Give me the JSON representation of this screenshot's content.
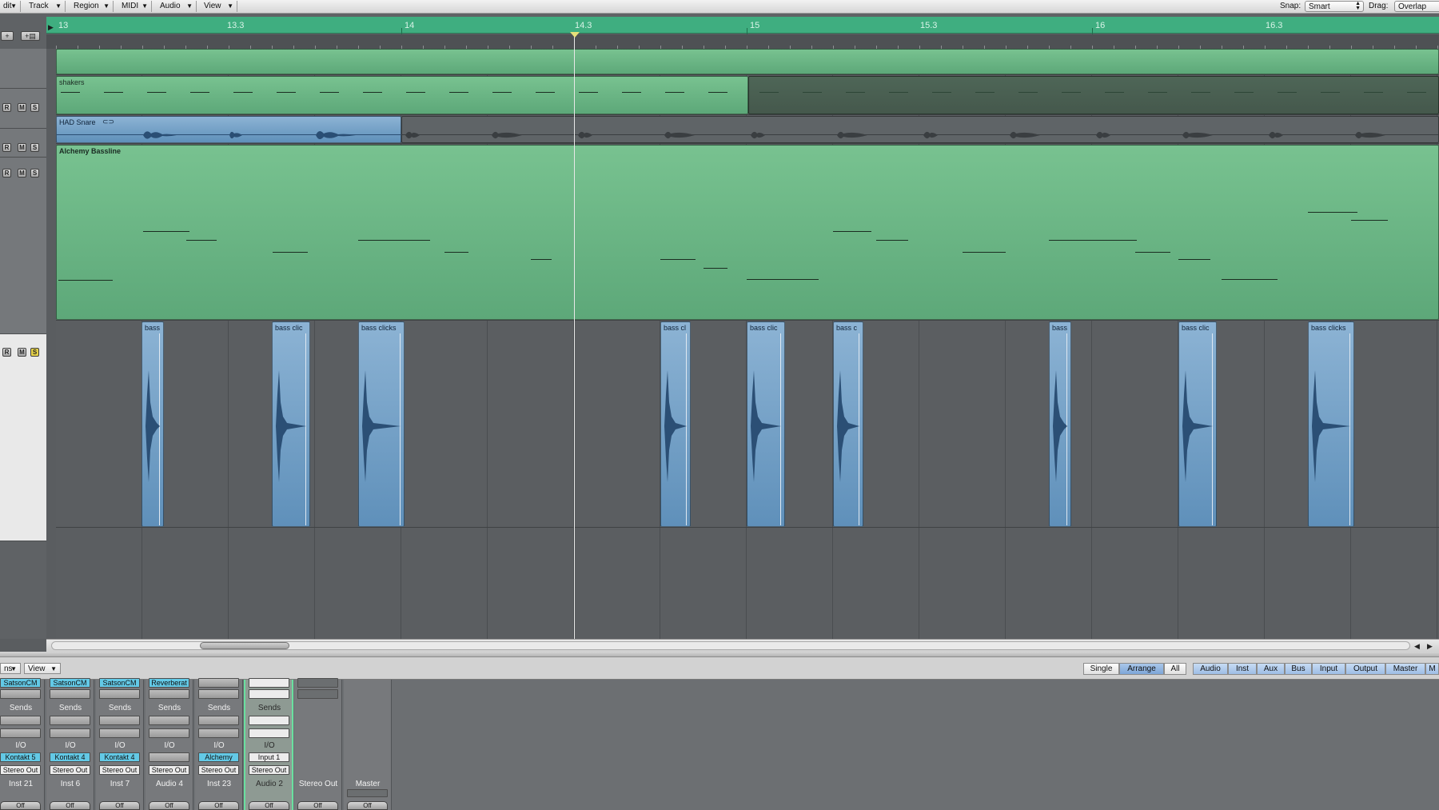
{
  "menubar": {
    "items": [
      {
        "id": "edit",
        "label": "dit"
      },
      {
        "id": "track",
        "label": "Track"
      },
      {
        "id": "region",
        "label": "Region"
      },
      {
        "id": "midi",
        "label": "MIDI"
      },
      {
        "id": "audio",
        "label": "Audio"
      },
      {
        "id": "view",
        "label": "View"
      }
    ],
    "snap_label": "Snap:",
    "snap_value": "Smart",
    "drag_label": "Drag:",
    "drag_value": "Overlap"
  },
  "ruler": {
    "labels": [
      "13",
      "13.3",
      "14",
      "14.3",
      "15",
      "15.3",
      "16",
      "16.3"
    ],
    "color": "#3fae80"
  },
  "tracks": {
    "buttons": {
      "record": "R",
      "mute": "M",
      "solo": "S"
    },
    "add_track": "+",
    "add_track_alt": "+▤"
  },
  "regions": {
    "shakers": "shakers",
    "snare": "HAD Snare",
    "bassline": "Alchemy Bassline",
    "clicks": [
      "bass",
      "bass clic",
      "bass clicks",
      "bass cl",
      "bass clic",
      "bass c",
      "bass",
      "bass clic",
      "bass clicks"
    ]
  },
  "mixer_toolbar": {
    "options_label": "ns",
    "view_label": "View",
    "single": "Single",
    "arrange": "Arrange",
    "all": "All",
    "filters": [
      "Audio",
      "Inst",
      "Aux",
      "Bus",
      "Input",
      "Output",
      "Master",
      "M"
    ]
  },
  "mixer": {
    "strips": [
      {
        "insert": "SatsonCM",
        "sends": "Sends",
        "io": "I/O",
        "input": "Kontakt 5",
        "output": "Stereo Out",
        "name": "Inst 21",
        "off": "Off"
      },
      {
        "insert": "SatsonCM",
        "sends": "Sends",
        "io": "I/O",
        "input": "Kontakt 4",
        "output": "Stereo Out",
        "name": "Inst 6",
        "off": "Off"
      },
      {
        "insert": "SatsonCM",
        "sends": "Sends",
        "io": "I/O",
        "input": "Kontakt 4",
        "output": "Stereo Out",
        "name": "Inst 7",
        "off": "Off"
      },
      {
        "insert": "Reverberat",
        "sends": "Sends",
        "io": "I/O",
        "input": "",
        "output": "Stereo Out",
        "name": "Audio 4",
        "off": "Off"
      },
      {
        "insert": "",
        "sends": "Sends",
        "io": "I/O",
        "input": "Alchemy",
        "output": "Stereo Out",
        "name": "Inst 23",
        "off": "Off"
      },
      {
        "insert": "",
        "sends": "Sends",
        "io": "I/O",
        "input": "Input 1",
        "output": "Stereo Out",
        "name": "Audio 2",
        "off": "Off"
      },
      {
        "insert": "",
        "sends": "",
        "io": "",
        "input": "",
        "output": "",
        "name": "Stereo Out",
        "off": "Off"
      },
      {
        "insert": "",
        "sends": "",
        "io": "",
        "input": "",
        "output": "",
        "name": "Master",
        "off": "Off"
      }
    ]
  },
  "colors": {
    "region_green": "#78c290",
    "region_blue": "#8cb3d4",
    "selected_strip_outline": "#6ae0a0",
    "instrument_slot": "#63c9e6",
    "solo_on": "#e6d24a"
  }
}
